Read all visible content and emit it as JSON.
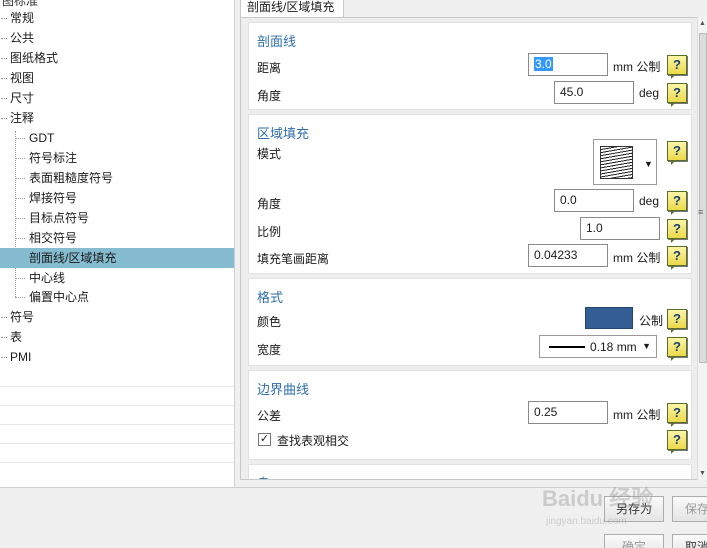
{
  "tree": {
    "top_partial": "图标准",
    "items": [
      {
        "label": "常规"
      },
      {
        "label": "公共"
      },
      {
        "label": "图纸格式"
      },
      {
        "label": "视图"
      },
      {
        "label": "尺寸"
      },
      {
        "label": "注释"
      },
      {
        "label": "GDT"
      },
      {
        "label": "符号标注"
      },
      {
        "label": "表面粗糙度符号"
      },
      {
        "label": "焊接符号"
      },
      {
        "label": "目标点符号"
      },
      {
        "label": "相交符号"
      },
      {
        "label": "剖面线/区域填充"
      },
      {
        "label": "中心线"
      },
      {
        "label": "偏置中心点"
      },
      {
        "label": "符号"
      },
      {
        "label": "表"
      },
      {
        "label": "PMI"
      }
    ]
  },
  "tab": {
    "label": "剖面线/区域填充"
  },
  "hatch": {
    "title": "剖面线",
    "distance_label": "距离",
    "distance_value": "3.0",
    "distance_unit": "mm 公制",
    "angle_label": "角度",
    "angle_value": "45.0",
    "angle_unit": "deg"
  },
  "area_fill": {
    "title": "区域填充",
    "pattern_label": "模式",
    "angle_label": "角度",
    "angle_value": "0.0",
    "angle_unit": "deg",
    "scale_label": "比例",
    "scale_value": "1.0",
    "pen_distance_label": "填充笔画距离",
    "pen_distance_value": "0.04233",
    "pen_distance_unit": "mm 公制"
  },
  "format": {
    "title": "格式",
    "color_label": "颜色",
    "color_value": "#335e94",
    "color_unit": "公制",
    "width_label": "宽度",
    "width_value": "0.18 mm"
  },
  "boundary": {
    "title": "边界曲线",
    "tolerance_label": "公差",
    "tolerance_value": "0.25",
    "tolerance_unit": "mm 公制",
    "find_intersect_label": "查找表观相交",
    "find_intersect_checked": true
  },
  "island": {
    "title": "岛"
  },
  "help_glyph": "?",
  "buttons": {
    "save_as": "另存为",
    "save": "保存",
    "ok": "确定",
    "cancel": "取消"
  },
  "watermark": {
    "text": "Baidu 经验",
    "sub": "jingyan.baidu.com"
  }
}
